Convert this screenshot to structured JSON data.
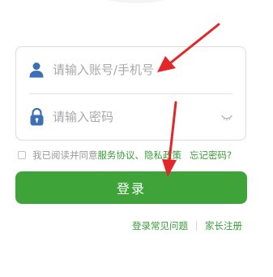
{
  "login_form": {
    "account_placeholder": "请输入账号/手机号",
    "account_icon": "person-icon",
    "password_placeholder": "请输入密码",
    "password_icon": "lock-icon",
    "visibility_icon": "eye-closed-icon"
  },
  "agreement": {
    "prefix": "我已阅读并同意",
    "service_label": "服务协议",
    "separator": "、",
    "privacy_label": "隐私政策",
    "forgot_password_label": "忘记密码?"
  },
  "actions": {
    "login_label": "登录"
  },
  "footer_links": {
    "faq_label": "登录常见问题",
    "parent_register_label": "家长注册"
  },
  "colors": {
    "accent_green": "#3ea43a",
    "link_green": "#3a9b3a",
    "annotation_red": "#e3262a",
    "icon_blue": "#3b6fb6"
  }
}
